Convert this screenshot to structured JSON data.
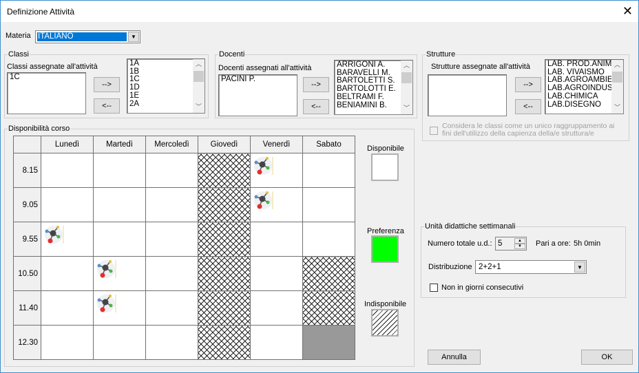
{
  "window": {
    "title": "Definizione Attività",
    "close": "✕"
  },
  "materia": {
    "label": "Materia",
    "value": "ITALIANO"
  },
  "classi": {
    "group": "Classi",
    "assigned_label": "Classi assegnate all'attività",
    "assigned": [
      "1C"
    ],
    "available": [
      "1A",
      "1B",
      "1C",
      "1D",
      "1E",
      "2A"
    ],
    "add": "-->",
    "remove": "<--"
  },
  "docenti": {
    "group": "Docenti",
    "assigned_label": "Docenti assegnati all'attività",
    "assigned": [
      "PACINI P."
    ],
    "available": [
      "ARRIGONI A.",
      "BARAVELLI M.",
      "BARTOLETTI  S.",
      "BARTOLOTTI E.",
      "BELTRAMI F.",
      "BENIAMINI B."
    ],
    "add": "-->",
    "remove": "<--"
  },
  "strutture": {
    "group": "Strutture",
    "assigned_label": "Strutture assegnate all'attività",
    "assigned": [],
    "available": [
      "LAB. PROD.ANIMA",
      "LAB. VIVAISMO",
      "LAB.AGROAMBIEN",
      "LAB.AGROINDUST",
      "LAB.CHIMICA",
      "LAB.DISEGNO"
    ],
    "add": "-->",
    "remove": "<--",
    "checkbox": "Considera le classi come un unico raggruppamento ai fini dell'utilizzo della capienza della/e struttura/e",
    "checked": false
  },
  "disponibilita": {
    "group": "Disponibilità corso",
    "days": [
      "Lunedì",
      "Martedì",
      "Mercoledì",
      "Giovedì",
      "Venerdì",
      "Sabato"
    ],
    "times": [
      "8.15",
      "9.05",
      "9.55",
      "10.50",
      "11.40",
      "12.30"
    ],
    "cells": [
      [
        "free",
        "free",
        "free",
        "unavailable",
        "scheduled",
        "free"
      ],
      [
        "free",
        "free",
        "free",
        "unavailable",
        "scheduled",
        "free"
      ],
      [
        "scheduled",
        "free",
        "free",
        "unavailable",
        "free",
        "free"
      ],
      [
        "free",
        "scheduled",
        "free",
        "unavailable",
        "free",
        "unavailable"
      ],
      [
        "free",
        "scheduled",
        "free",
        "unavailable",
        "free",
        "unavailable"
      ],
      [
        "free",
        "free",
        "free",
        "unavailable",
        "free",
        "blocked"
      ]
    ],
    "legend": [
      {
        "label": "Disponibile",
        "color": "#ffffff"
      },
      {
        "label": "Preferenza",
        "color": "#00ff00"
      },
      {
        "label": "Indisponibile",
        "color": "hatched"
      }
    ]
  },
  "unita": {
    "group": "Unità didattiche settimanali",
    "totale_label": "Numero totale u.d.:",
    "totale": "5",
    "ore_label": "Pari a ore:",
    "ore": "5h 0min",
    "distribuzione_label": "Distribuzione",
    "distribuzione": "2+2+1",
    "consecutivi": "Non in giorni consecutivi",
    "consecutivi_checked": false
  },
  "buttons": {
    "annulla": "Annulla",
    "ok": "OK"
  }
}
